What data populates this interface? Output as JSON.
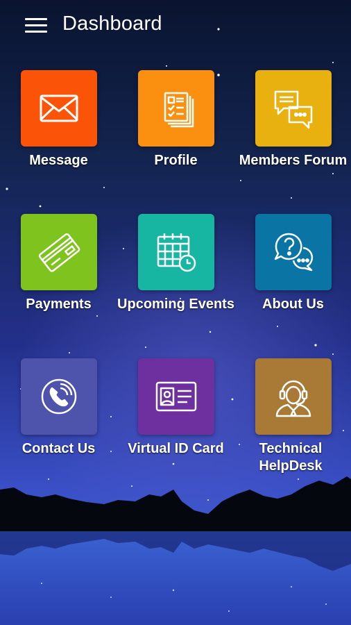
{
  "header": {
    "title": "Dashboard",
    "menu_icon": "hamburger-menu-icon"
  },
  "colors": {
    "message": "#fb5308",
    "profile": "#fb8f0f",
    "members_forum": "#e8b10f",
    "payments": "#7fc31f",
    "upcoming_events": "#17b6a2",
    "about_us": "#0a75a4",
    "contact_us": "#4e53ab",
    "virtual_id_card": "#6e2f9f",
    "technical_helpdesk": "#a97a35"
  },
  "tiles": [
    {
      "label": "Message",
      "icon": "envelope-icon"
    },
    {
      "label": "Profile",
      "icon": "document-checklist-icon"
    },
    {
      "label": "Members Forum",
      "icon": "chat-bubbles-icon"
    },
    {
      "label": "Payments",
      "icon": "credit-card-icon"
    },
    {
      "label": "Upcoming Events",
      "icon": "calendar-clock-icon"
    },
    {
      "label": "About Us",
      "icon": "question-chat-icon"
    },
    {
      "label": "Contact Us",
      "icon": "phone-call-icon"
    },
    {
      "label": "Virtual ID Card",
      "icon": "id-card-icon"
    },
    {
      "label": "Technical HelpDesk",
      "icon": "support-agent-icon"
    }
  ]
}
